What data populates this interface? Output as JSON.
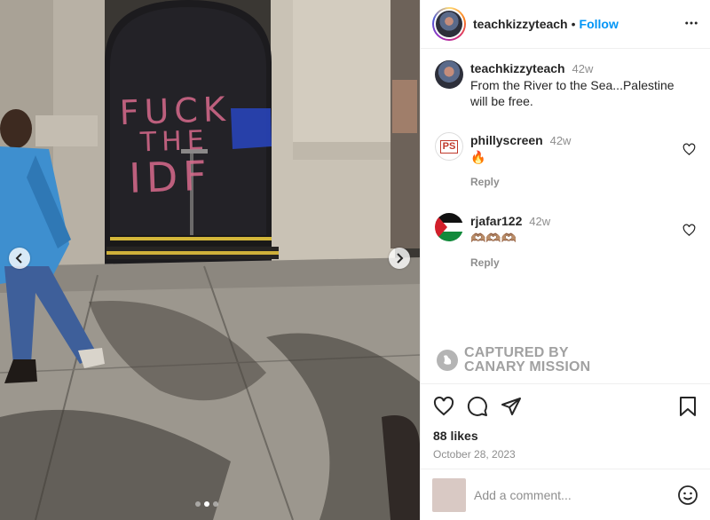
{
  "post": {
    "username": "teachkizzyteach",
    "separator": "•",
    "follow_label": "Follow",
    "more_icon": "more-horizontal-icon"
  },
  "photo": {
    "graffiti_lines": [
      "FUCK",
      "THE",
      "IDF"
    ],
    "dots_total": 3,
    "dots_active": 2
  },
  "caption": {
    "username": "teachkizzyteach",
    "time": "42w",
    "text": "From the River to the Sea...Palestine will be free."
  },
  "comments": [
    {
      "username": "phillyscreen",
      "time": "42w",
      "text": "🔥",
      "reply_label": "Reply"
    },
    {
      "username": "rjafar122",
      "time": "42w",
      "text": "🫶🏽🫶🏽🫶🏽",
      "reply_label": "Reply"
    }
  ],
  "watermark": {
    "line1": "CAPTURED BY",
    "line2": "CANARY MISSION"
  },
  "stats": {
    "likes": "88 likes",
    "date": "October 28, 2023"
  },
  "add_comment": {
    "placeholder": "Add a comment..."
  },
  "colors": {
    "accent": "#0095f6",
    "muted": "#8e8e8e",
    "text": "#262626"
  }
}
